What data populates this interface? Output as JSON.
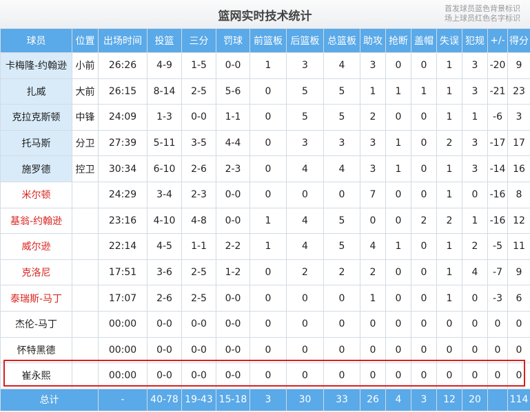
{
  "title": "篮网实时技术统计",
  "legend": [
    "首发球员蓝色背景标识",
    "场上球员红色名字标识"
  ],
  "columns": [
    "球员",
    "位置",
    "出场时间",
    "投篮",
    "三分",
    "罚球",
    "前篮板",
    "后篮板",
    "总篮板",
    "助攻",
    "抢断",
    "盖帽",
    "失误",
    "犯规",
    "+/-",
    "得分"
  ],
  "rows": [
    {
      "type": "starter",
      "cells": [
        "卡梅隆-约翰逊",
        "小前",
        "26:26",
        "4-9",
        "1-5",
        "0-0",
        "1",
        "3",
        "4",
        "3",
        "0",
        "0",
        "1",
        "3",
        "-20",
        "9"
      ]
    },
    {
      "type": "starter",
      "cells": [
        "扎威",
        "大前",
        "26:15",
        "8-14",
        "2-5",
        "5-6",
        "0",
        "5",
        "5",
        "1",
        "1",
        "1",
        "1",
        "3",
        "-21",
        "23"
      ]
    },
    {
      "type": "starter",
      "cells": [
        "克拉克斯顿",
        "中锋",
        "24:09",
        "1-3",
        "0-0",
        "1-1",
        "0",
        "5",
        "5",
        "2",
        "0",
        "0",
        "1",
        "1",
        "-6",
        "3"
      ]
    },
    {
      "type": "starter",
      "cells": [
        "托马斯",
        "分卫",
        "27:39",
        "5-11",
        "3-5",
        "4-4",
        "0",
        "3",
        "3",
        "3",
        "1",
        "0",
        "2",
        "3",
        "-17",
        "17"
      ]
    },
    {
      "type": "starter",
      "cells": [
        "施罗德",
        "控卫",
        "30:34",
        "6-10",
        "2-6",
        "2-3",
        "0",
        "4",
        "4",
        "3",
        "1",
        "0",
        "1",
        "3",
        "-14",
        "16"
      ]
    },
    {
      "type": "bench",
      "cells": [
        "米尔顿",
        "",
        "24:29",
        "3-4",
        "2-3",
        "0-0",
        "0",
        "0",
        "0",
        "7",
        "0",
        "0",
        "1",
        "0",
        "-16",
        "8"
      ]
    },
    {
      "type": "bench",
      "cells": [
        "基翁-约翰逊",
        "",
        "23:16",
        "4-10",
        "4-8",
        "0-0",
        "1",
        "4",
        "5",
        "0",
        "0",
        "2",
        "2",
        "1",
        "-16",
        "12"
      ]
    },
    {
      "type": "bench",
      "cells": [
        "威尔逊",
        "",
        "22:14",
        "4-5",
        "1-1",
        "2-2",
        "1",
        "4",
        "5",
        "4",
        "1",
        "0",
        "1",
        "2",
        "-5",
        "11"
      ]
    },
    {
      "type": "bench",
      "cells": [
        "克洛尼",
        "",
        "17:51",
        "3-6",
        "2-5",
        "1-2",
        "0",
        "2",
        "2",
        "2",
        "0",
        "0",
        "1",
        "4",
        "-7",
        "9"
      ]
    },
    {
      "type": "bench",
      "cells": [
        "泰瑞斯-马丁",
        "",
        "17:07",
        "2-6",
        "2-5",
        "0-0",
        "0",
        "0",
        "0",
        "1",
        "0",
        "0",
        "1",
        "0",
        "-3",
        "6"
      ]
    },
    {
      "type": "other",
      "cells": [
        "杰伦-马丁",
        "",
        "00:00",
        "0-0",
        "0-0",
        "0-0",
        "0",
        "0",
        "0",
        "0",
        "0",
        "0",
        "0",
        "0",
        "0",
        "0"
      ]
    },
    {
      "type": "other",
      "cells": [
        "怀特黑德",
        "",
        "00:00",
        "0-0",
        "0-0",
        "0-0",
        "0",
        "0",
        "0",
        "0",
        "0",
        "0",
        "0",
        "0",
        "0",
        "0"
      ]
    },
    {
      "type": "other",
      "cells": [
        "崔永熙",
        "",
        "00:00",
        "0-0",
        "0-0",
        "0-0",
        "0",
        "0",
        "0",
        "0",
        "0",
        "0",
        "0",
        "0",
        "0",
        "0"
      ]
    }
  ],
  "totals": [
    "总计",
    "",
    "-",
    "40-78",
    "19-43",
    "15-18",
    "3",
    "30",
    "33",
    "26",
    "4",
    "3",
    "12",
    "20",
    "",
    "114"
  ],
  "highlight_row": 12,
  "colors": {
    "header_bg": "#5aa9e8",
    "starter_bg": "#d9ebf9",
    "bench_name": "#d8251f",
    "highlight_border": "#d81e1e"
  }
}
